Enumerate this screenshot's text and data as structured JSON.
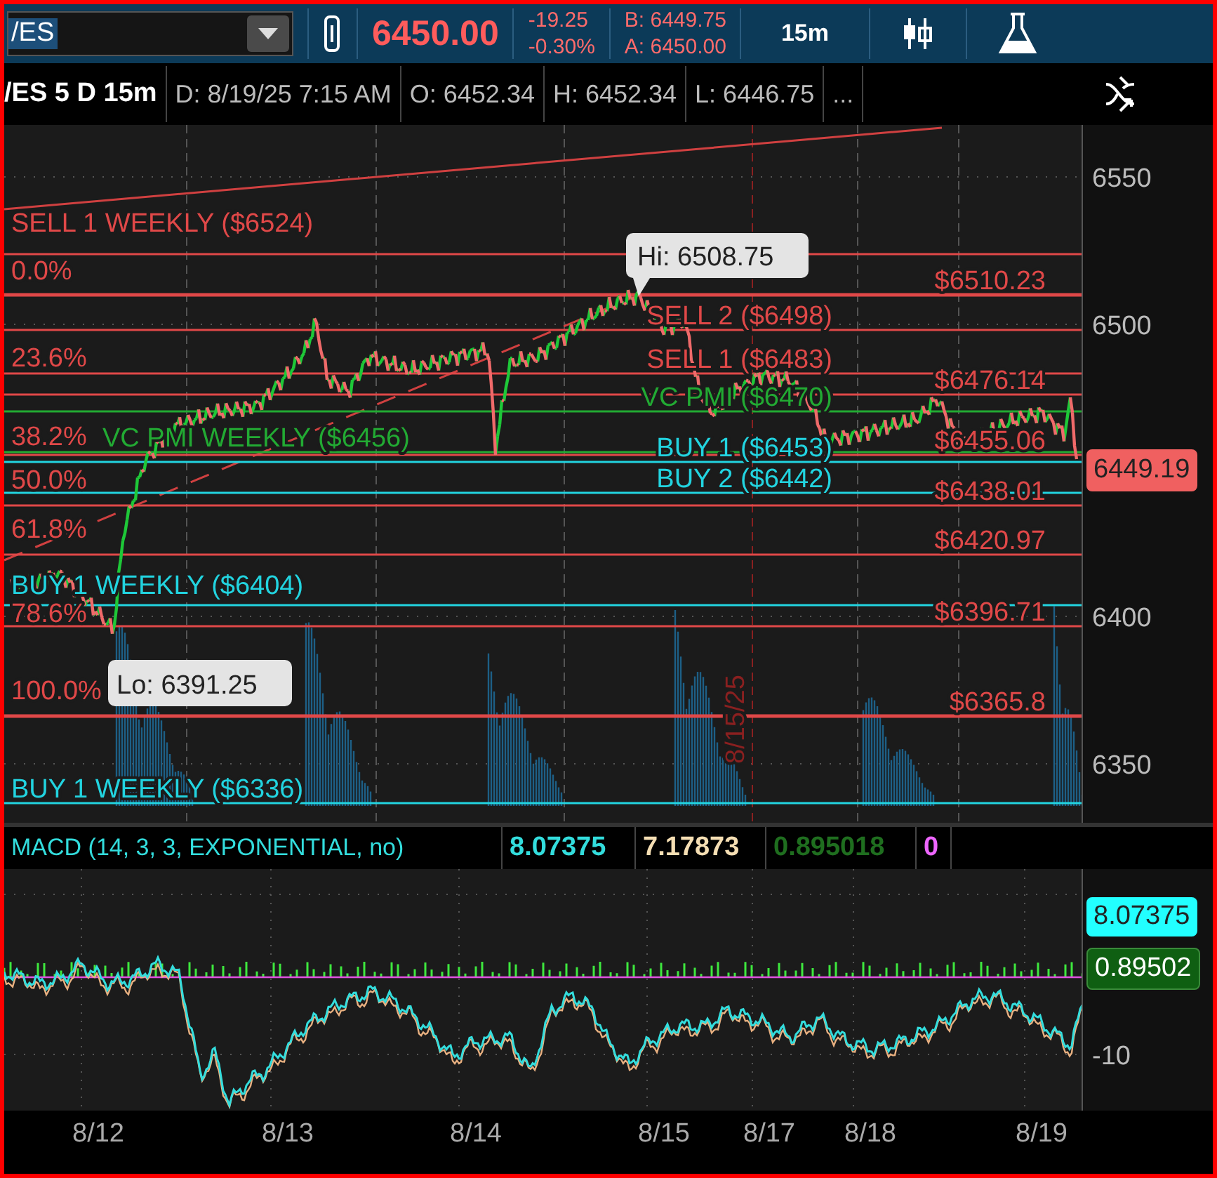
{
  "toolbar": {
    "symbol": "/ES",
    "last": "6450.00",
    "change": "-19.25",
    "change_pct": "-0.30%",
    "bid": "B: 6449.75",
    "ask": "A: 6450.00",
    "timeframe": "15m"
  },
  "header": {
    "title": "/ES 5 D 15m",
    "fields": [
      "D: 8/19/25 7:15 AM",
      "O: 6452.34",
      "H: 6452.34",
      "L: 6446.75",
      "..."
    ]
  },
  "price_axis": {
    "ticks": [
      "6550",
      "6500",
      "6400",
      "6350"
    ],
    "current": "6449.19"
  },
  "levels": [
    {
      "kind": "named",
      "label": "SELL 1 WEEKLY ($6524)",
      "color": "#e04848"
    },
    {
      "kind": "fib",
      "percent": "0.0%",
      "price": "$6510.23",
      "color": "#e04848"
    },
    {
      "kind": "named",
      "label": "SELL 2 ($6498)",
      "color": "#e04848"
    },
    {
      "kind": "named",
      "label": "SELL 1 ($6483)",
      "color": "#e04848"
    },
    {
      "kind": "fib",
      "percent": "23.6%",
      "price": "$6476.14",
      "color": "#e04848"
    },
    {
      "kind": "named",
      "label": "VC PMI ($6470)",
      "color": "#22aa33"
    },
    {
      "kind": "named",
      "label": "VC PMI WEEKLY ($6456)",
      "color": "#22aa33"
    },
    {
      "kind": "fib",
      "percent": "38.2%",
      "price": "$6455.06",
      "color": "#e04848"
    },
    {
      "kind": "named",
      "label": "BUY 1 ($6453)",
      "color": "#22d4e0"
    },
    {
      "kind": "named",
      "label": "BUY 2 ($6442)",
      "color": "#22d4e0"
    },
    {
      "kind": "fib",
      "percent": "50.0%",
      "price": "$6438.01",
      "color": "#e04848"
    },
    {
      "kind": "fib",
      "percent": "61.8%",
      "price": "$6420.97",
      "color": "#e04848"
    },
    {
      "kind": "named",
      "label": "BUY 1 WEEKLY ($6404)",
      "color": "#22d4e0"
    },
    {
      "kind": "fib",
      "percent": "78.6%",
      "price": "$6396.71",
      "color": "#e04848"
    },
    {
      "kind": "fib",
      "percent": "100.0%",
      "price": "$6365.8",
      "color": "#e04848"
    },
    {
      "kind": "named",
      "label": "BUY 1 WEEKLY ($6336)",
      "color": "#22d4e0"
    }
  ],
  "markers": {
    "high": "Hi: 6508.75",
    "low": "Lo: 6391.25",
    "date_line": "8/15/25"
  },
  "macd": {
    "title": "MACD (14, 3, 3, EXPONENTIAL, no)",
    "values": [
      {
        "text": "8.07375",
        "color": "#33dddd"
      },
      {
        "text": "7.17873",
        "color": "#f5deb3"
      },
      {
        "text": "0.895018",
        "color": "#1f6e1f"
      },
      {
        "text": "0",
        "color": "#ee66ff"
      }
    ],
    "axis_tick": "-10",
    "value_tag": "8.07375",
    "diff_tag": "0.89502"
  },
  "dates": [
    "8/12",
    "8/13",
    "8/14",
    "8/15",
    "8/17",
    "8/18",
    "8/19"
  ]
}
